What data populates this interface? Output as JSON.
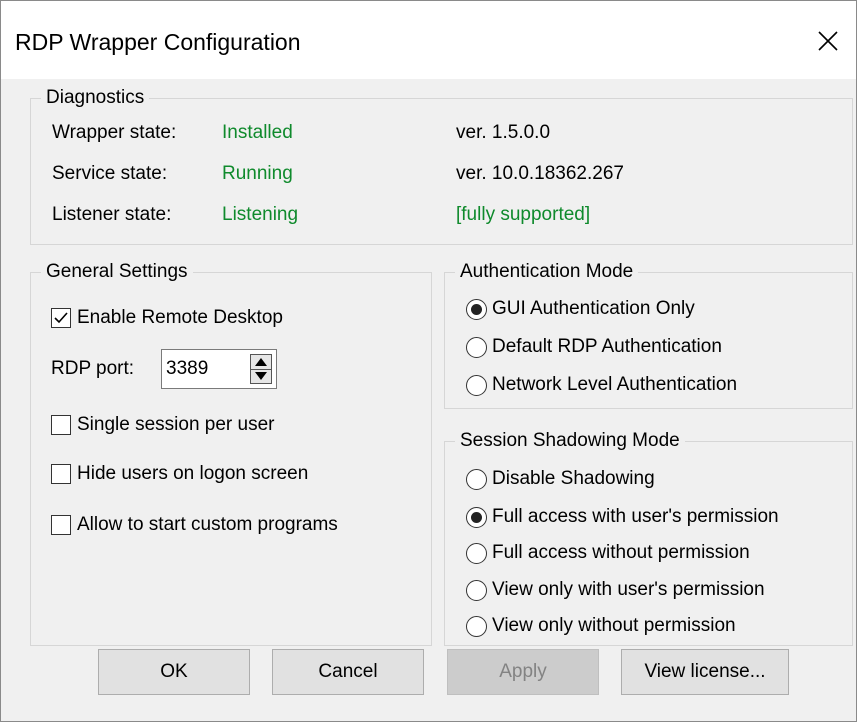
{
  "window": {
    "title": "RDP Wrapper Configuration"
  },
  "diagnostics": {
    "legend": "Diagnostics",
    "wrapper_label": "Wrapper state:",
    "wrapper_value": "Installed",
    "wrapper_version": "ver. 1.5.0.0",
    "service_label": "Service state:",
    "service_value": "Running",
    "service_version": "ver. 10.0.18362.267",
    "listener_label": "Listener state:",
    "listener_value": "Listening",
    "support_status": "[fully supported]",
    "status_color": "#0f8a2c"
  },
  "general": {
    "legend": "General Settings",
    "enable_rdp": {
      "label": "Enable Remote Desktop",
      "checked": true
    },
    "port_label": "RDP port:",
    "port_value": "3389",
    "single_session": {
      "label": "Single session per user",
      "checked": false
    },
    "hide_users": {
      "label": "Hide users on logon screen",
      "checked": false
    },
    "custom_programs": {
      "label": "Allow to start custom programs",
      "checked": false
    }
  },
  "auth": {
    "legend": "Authentication Mode",
    "options": [
      "GUI Authentication Only",
      "Default RDP Authentication",
      "Network Level Authentication"
    ],
    "selected": 0
  },
  "shadow": {
    "legend": "Session Shadowing Mode",
    "options": [
      "Disable Shadowing",
      "Full access with user's permission",
      "Full access without permission",
      "View only with user's permission",
      "View only without permission"
    ],
    "selected": 1
  },
  "buttons": {
    "ok": "OK",
    "cancel": "Cancel",
    "apply": "Apply",
    "view_license": "View license..."
  },
  "icons": {
    "close": "close-icon",
    "check": "checkmark-icon",
    "spin_up": "triangle-up-icon",
    "spin_down": "triangle-down-icon"
  }
}
